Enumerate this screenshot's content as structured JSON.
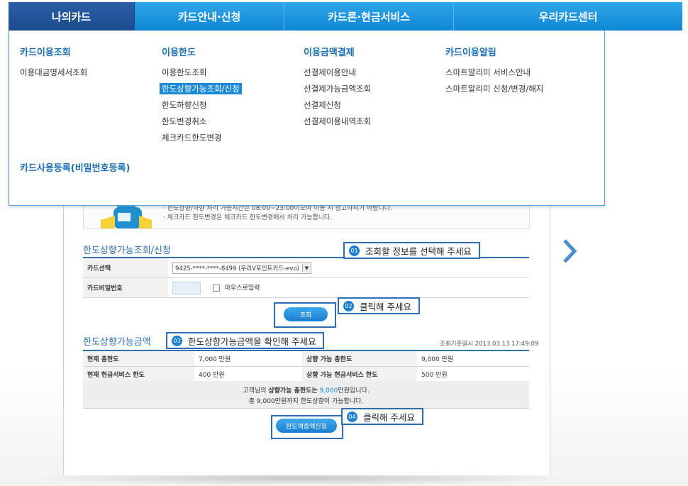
{
  "nav": {
    "tabs": [
      {
        "label": "나의카드",
        "active": true
      },
      {
        "label": "카드안내·신청",
        "active": false
      },
      {
        "label": "카드론·현금서비스",
        "active": false
      },
      {
        "label": "우리카드센터",
        "active": false
      }
    ]
  },
  "menu": {
    "col1": {
      "title": "카드이용조회",
      "items": [
        "이용대금명세서조회"
      ]
    },
    "col2": {
      "title": "이용한도",
      "items": [
        "이용한도조회",
        "한도상향가능조회/신청",
        "한도하향신청",
        "한도변경취소",
        "체크카드한도변경"
      ]
    },
    "col3": {
      "title": "이용금액결제",
      "items": [
        "선결제이용안내",
        "선결제가능금액조회",
        "선결제신청",
        "선결제이용내역조회"
      ]
    },
    "col4": {
      "title": "카드이용알림",
      "items": [
        "스마트알리미 서비스안내",
        "스마트알리미 신청/변경/해지"
      ]
    },
    "bottom_title": "카드사용등록(비밀번호등록)"
  },
  "notice": {
    "line1": "· 한도상향/하향 처리 가능시간은 08:00~23:00이오며 이용 시 참고하시기 바랍니다.",
    "line2": "· 체크카드 한도변경은 체크카드 한도변경에서 처리 가능합니다."
  },
  "inquiry": {
    "title": "한도상향가능조회/신청",
    "card_label": "카드선택",
    "card_value": "9425-****-****-8499 (우리V포인트카드-evo)",
    "pw_label": "카드비밀번호",
    "mouse_input_label": "마우스로입력",
    "search_button": "조회"
  },
  "result": {
    "title": "한도상향가능금액",
    "timestamp": "조회기준일시  2013.03.13 17:49:09",
    "rows": [
      {
        "l1": "현재 총한도",
        "v1": "7,000 만원",
        "l2": "상향 가능 총한도",
        "v2": "9,000 만원"
      },
      {
        "l1": "현재 현금서비스 한도",
        "v1": "400 만원",
        "l2": "상향 가능 현금서비스 한도",
        "v2": "500 만원"
      }
    ],
    "summary_pre": "고객님의 ",
    "summary_bold": "상향가능 총한도는",
    "summary_value": "9,000",
    "summary_post": "만원입니다.",
    "summary_line2": "총 9,000만원까지 한도상향이 가능합니다.",
    "apply_button": "한도액증액신청"
  },
  "callouts": {
    "c1": {
      "num": "01",
      "text": "조회할 정보를 선택해 주세요"
    },
    "c2": {
      "num": "02",
      "text": "클릭해 주세요"
    },
    "c3": {
      "num": "03",
      "text": "한도상향가능금액을 확인해 주세요"
    },
    "c4": {
      "num": "04",
      "text": "클릭해 주세요"
    }
  },
  "colors": {
    "accent": "#1a8ad6",
    "nav_active": "#1c4a8c",
    "callout_border": "#2c6dba"
  }
}
